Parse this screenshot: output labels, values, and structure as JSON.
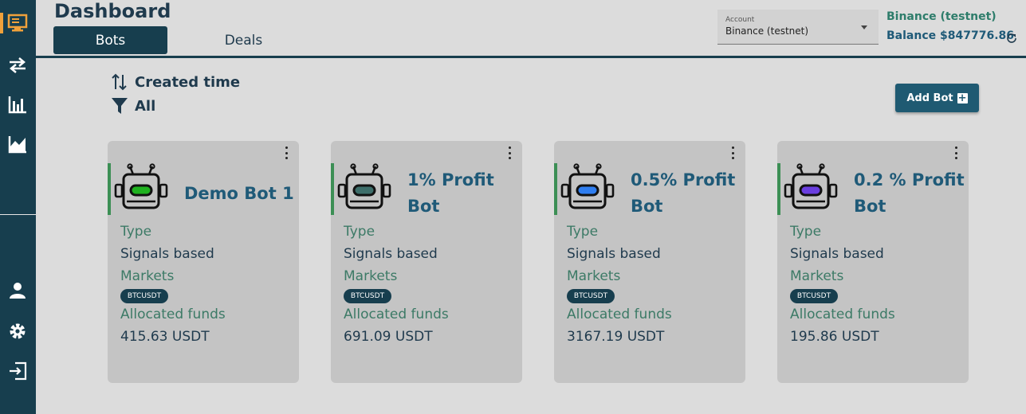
{
  "header": {
    "title": "Dashboard",
    "tabs": [
      {
        "label": "Bots"
      },
      {
        "label": "Deals"
      }
    ]
  },
  "account": {
    "label": "Account",
    "value": "Binance (testnet)",
    "exchange": "Binance (testnet)",
    "balance": "Balance $847776.86"
  },
  "toolbar": {
    "sort_label": "Created time",
    "filter_label": "All",
    "add_bot_label": "Add Bot",
    "add_bot_icon": "+"
  },
  "cards": [
    {
      "name": "Demo Bot 1",
      "type_label": "Type",
      "type_value": "Signals based",
      "markets_label": "Markets",
      "market": "BTCUSDT",
      "funds_label": "Allocated funds",
      "funds": "415.63 USDT",
      "eye_color": "#1fb21f"
    },
    {
      "name": "1% Profit Bot",
      "type_label": "Type",
      "type_value": "Signals based",
      "markets_label": "Markets",
      "market": "BTCUSDT",
      "funds_label": "Allocated funds",
      "funds": "691.09 USDT",
      "eye_color": "#3d6e6a"
    },
    {
      "name": "0.5% Profit Bot",
      "type_label": "Type",
      "type_value": "Signals based",
      "markets_label": "Markets",
      "market": "BTCUSDT",
      "funds_label": "Allocated funds",
      "funds": "3167.19 USDT",
      "eye_color": "#2f7ef0"
    },
    {
      "name": "0.2 % Profit Bot",
      "type_label": "Type",
      "type_value": "Signals based",
      "markets_label": "Markets",
      "market": "BTCUSDT",
      "funds_label": "Allocated funds",
      "funds": "195.86 USDT",
      "eye_color": "#6a3ee0"
    }
  ],
  "sidebar": {
    "icons": [
      "monitor-icon",
      "transfer-icon",
      "bar-chart-icon",
      "area-chart-icon",
      "user-icon",
      "gear-icon",
      "logout-icon"
    ]
  },
  "colors": {
    "sidebar": "#173e4e",
    "active_icon": "#f0a13b",
    "card_accent": "#3c8f55"
  }
}
